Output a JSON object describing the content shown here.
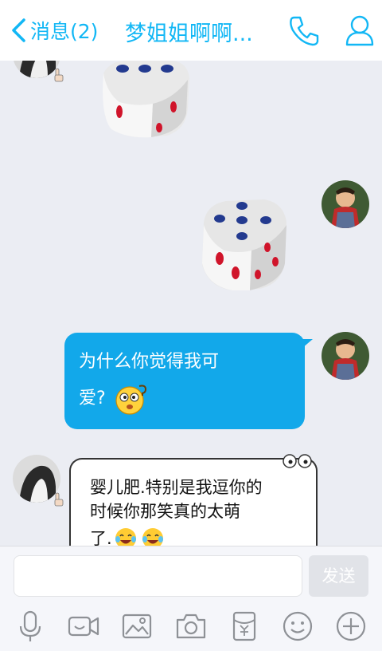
{
  "header": {
    "back_label": "消息(2)",
    "title": "梦姐姐啊啊...",
    "accent": "#12b7f5"
  },
  "messages": [
    {
      "from": "contact",
      "type": "dice",
      "dice_value": 3
    },
    {
      "from": "me",
      "type": "dice",
      "dice_value": 5
    },
    {
      "from": "me",
      "type": "text",
      "lines": [
        "为什么你觉得我可",
        "爱?"
      ],
      "emoji": "thinking-face"
    },
    {
      "from": "contact",
      "type": "text",
      "lines": [
        "婴儿肥.特别是我逗你的",
        "时候你那笑真的太萌",
        "了."
      ],
      "emoji": "laughing-tears-face"
    }
  ],
  "input": {
    "value": "",
    "send_label": "发送"
  },
  "toolbar": [
    "voice-icon",
    "video-call-icon",
    "image-icon",
    "camera-icon",
    "red-packet-icon",
    "emoji-icon",
    "plus-icon"
  ]
}
